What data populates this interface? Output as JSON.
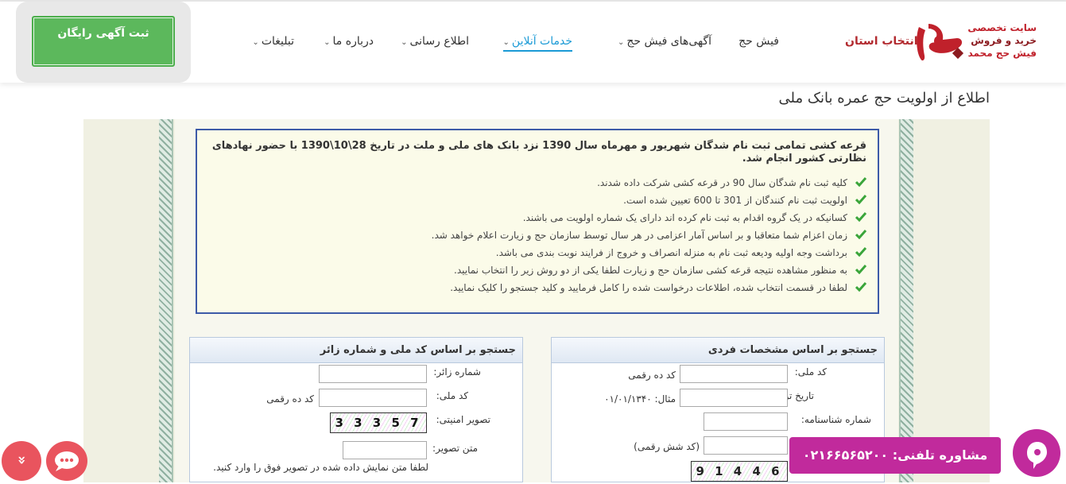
{
  "header": {
    "logo_line1": "سایت تخصصی",
    "logo_line2": "خرید و فروش",
    "logo_line3": "فیش حج محمد",
    "province_label": "انتخاب استان",
    "nav": [
      {
        "label": "فیش حج",
        "dropdown": false
      },
      {
        "label": "آگهی‌های فیش حج",
        "dropdown": true
      },
      {
        "label": "خدمات آنلاین",
        "dropdown": true,
        "active": true
      },
      {
        "label": "اطلاع رسانی",
        "dropdown": true
      },
      {
        "label": "درباره ما",
        "dropdown": true
      },
      {
        "label": "تبلیغات",
        "dropdown": true
      }
    ],
    "ad_button": "ثبت آگهی رایگان"
  },
  "page": {
    "title": "اطلاع از اولویت حج عمره بانک ملی"
  },
  "info": {
    "heading": "قرعه کشی تمامی ثبت نام شدگان شهریور و مهرماه سال 1390 نزد بانک های ملی و ملت در تاریخ 28\\10\\1390 با حضور نهادهای نظارتی کشور انجام شد.",
    "items": [
      "کلیه ثبت نام شدگان سال 90 در قرعه کشی شرکت داده شدند.",
      "اولویت ثبت نام کنندگان از 301 تا 600 تعیین شده است.",
      "کسانیکه در یک گروه اقدام به ثبت نام کرده اند دارای یک شماره اولویت می باشند.",
      "زمان اعزام شما متعاقبا و بر اساس آمار اعزامی در هر سال توسط سازمان حج و زیارت اعلام خواهد شد.",
      "برداشت وجه اولیه ودیعه ثبت نام به منزله انصراف و خروج از فرایند نوبت بندی می باشد.",
      "به منظور مشاهده نتیجه قرعه کشی سازمان حج و زیارت لطفا یکی از دو روش زیر را انتخاب نمایید.",
      "لطفا در قسمت انتخاب شده، اطلاعات درخواست شده را کامل فرمایید و کلید جستجو را کلیک نمایید."
    ]
  },
  "panel_personal": {
    "title": "جستجو بر اساس مشخصات فردی",
    "national_code_label": "کد ملی:",
    "national_code_hint": "کد ده رقمی",
    "birth_date_label": "تاریخ تولد:",
    "birth_date_hint": "مثال: ۰۱/۰۱/۱۳۴۰",
    "id_number_label": "شماره شناسنامه:",
    "serial_hint": "(کد شش رقمی)",
    "captcha_text": "6 4 4 1 9"
  },
  "panel_pilgrim": {
    "title": "جستجو بر اساس کد ملی و شماره زائر",
    "pilgrim_no_label": "شماره زائر:",
    "national_code_label": "کد ملی:",
    "national_code_hint": "کد ده رقمی",
    "captcha_label": "تصویر امنیتی:",
    "captcha_text": "7 5 3 3 3",
    "captcha_input_label": "متن تصویر:",
    "captcha_note": "لطفا متن نمایش داده شده در تصویر فوق را وارد کنید."
  },
  "floating": {
    "scroll_up": "«",
    "phone_text": "مشاوره تلفنی: ۰۲۱۶۶۵۶۵۲۰۰"
  }
}
